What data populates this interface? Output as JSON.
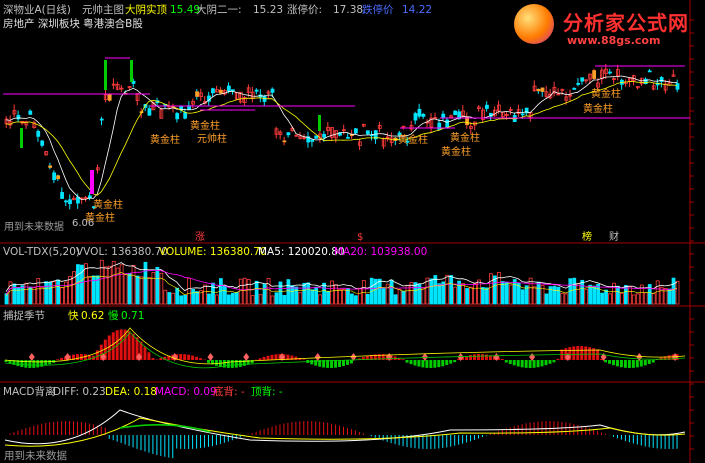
{
  "header": {
    "stock_label": "深物业A(日线)",
    "indicator_name": "元帅主图",
    "yin_solid_label": "大阴实顶",
    "yin_solid_value": "15.49",
    "big_yin_label": "大阴二一:",
    "big_yin_value": "15.23",
    "limit_up_label": "涨停价:",
    "limit_up_value": "17.38",
    "limit_down_label": "跌停价",
    "limit_down_value": "14.22",
    "sector_line": "房地产  深圳板块  粤港澳合B股"
  },
  "main_panel": {
    "annotations": [
      "黄金柱",
      "黄金柱",
      "元帅柱",
      "黄金柱",
      "黄金柱",
      "黄金柱",
      "黄金柱",
      "黄金柱",
      "黄金柱",
      "黄金柱"
    ],
    "marks": {
      "zhang": "涨",
      "s": "$",
      "bang": "榜",
      "cai": "财"
    },
    "future_data": "用到未来数据",
    "small_value": "6.06"
  },
  "vol_panel": {
    "name": "VOL-TDX(5,20)",
    "vvol": "VVOL: 136380.70",
    "volume": "VOLUME: 136380.70",
    "ma5": "MA5: 120020.80",
    "ma20": "MA20: 103938.00"
  },
  "capture_panel": {
    "name": "捕捉季节",
    "fast_label": "快",
    "fast_value": "0.62",
    "slow_label": "慢",
    "slow_value": "0.71"
  },
  "macd_panel": {
    "name": "MACD背离",
    "diff": "DIFF: 0.23",
    "dea": "DEA: 0.18",
    "macd": "MACD: 0.09",
    "bottom_div": "底背: -",
    "top_div": "顶背: -",
    "future_data": "用到未来数据"
  },
  "logo": {
    "title": "分析家公式网",
    "url": "www.88gs.com"
  },
  "colors": {
    "up": "#ff3c3c",
    "down": "#00e5ff",
    "annotation": "#ffa028",
    "magenta": "#ff00ff",
    "ma_white": "#ffffff",
    "ma_yellow": "#ffff00",
    "green": "#00cc00",
    "red": "#e01010"
  }
}
